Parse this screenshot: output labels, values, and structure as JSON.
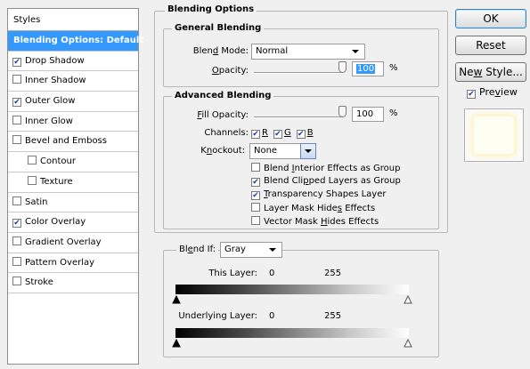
{
  "styles": {
    "header": "Styles",
    "items": [
      {
        "label": "Blending Options: Default",
        "checked": null,
        "selected": true,
        "sub": false
      },
      {
        "label": "Drop Shadow",
        "checked": true,
        "selected": false,
        "sub": false
      },
      {
        "label": "Inner Shadow",
        "checked": false,
        "selected": false,
        "sub": false
      },
      {
        "label": "Outer Glow",
        "checked": true,
        "selected": false,
        "sub": false
      },
      {
        "label": "Inner Glow",
        "checked": false,
        "selected": false,
        "sub": false
      },
      {
        "label": "Bevel and Emboss",
        "checked": false,
        "selected": false,
        "sub": false
      },
      {
        "label": "Contour",
        "checked": false,
        "selected": false,
        "sub": true
      },
      {
        "label": "Texture",
        "checked": false,
        "selected": false,
        "sub": true
      },
      {
        "label": "Satin",
        "checked": false,
        "selected": false,
        "sub": false
      },
      {
        "label": "Color Overlay",
        "checked": true,
        "selected": false,
        "sub": false
      },
      {
        "label": "Gradient Overlay",
        "checked": false,
        "selected": false,
        "sub": false
      },
      {
        "label": "Pattern Overlay",
        "checked": false,
        "selected": false,
        "sub": false
      },
      {
        "label": "Stroke",
        "checked": false,
        "selected": false,
        "sub": false
      }
    ]
  },
  "blending": {
    "title": "Blending Options",
    "general": {
      "title": "General Blending",
      "blend_mode_label_a": "Blen",
      "blend_mode_label_u": "d",
      "blend_mode_label_b": " Mode:",
      "blend_mode_value": "Normal",
      "opacity_label_u": "O",
      "opacity_label_b": "pacity:",
      "opacity_value": "100",
      "opacity_unit": "%"
    },
    "advanced": {
      "title": "Advanced Blending",
      "fill_opacity_label_u": "F",
      "fill_opacity_label_b": "ill Opacity:",
      "fill_opacity_value": "100",
      "fill_opacity_unit": "%",
      "channels_label": "Channels:",
      "channels": [
        {
          "label": "R",
          "checked": true
        },
        {
          "label": "G",
          "checked": true
        },
        {
          "label": "B",
          "checked": true
        }
      ],
      "knockout_label_a": "K",
      "knockout_label_u": "n",
      "knockout_label_b": "ockout:",
      "knockout_value": "None",
      "options": [
        {
          "pre": "Blend ",
          "u": "I",
          "post": "nterior Effects as Group",
          "checked": false
        },
        {
          "pre": "Blend Cli",
          "u": "p",
          "post": "ped Layers as Group",
          "checked": true
        },
        {
          "pre": "",
          "u": "T",
          "post": "ransparency Shapes Layer",
          "checked": true
        },
        {
          "pre": "Layer Mask Hide",
          "u": "s",
          "post": " Effects",
          "checked": false
        },
        {
          "pre": "Vector Mask ",
          "u": "H",
          "post": "ides Effects",
          "checked": false
        }
      ]
    },
    "blend_if": {
      "label_a": "Bl",
      "label_u": "e",
      "label_b": "nd If:",
      "value": "Gray",
      "this_layer_label": "This Layer:",
      "this_layer_min": "0",
      "this_layer_max": "255",
      "underlying_label": "Underlying Layer:",
      "underlying_min": "0",
      "underlying_max": "255"
    }
  },
  "actions": {
    "ok": "OK",
    "reset": "Reset",
    "new_style_a": "Ne",
    "new_style_u": "w",
    "new_style_b": " Style...",
    "preview_a": "Pre",
    "preview_u": "v",
    "preview_b": "iew",
    "preview_checked": true
  },
  "colors": {
    "selection": "#3399ff",
    "check": "#1b3fa8"
  }
}
